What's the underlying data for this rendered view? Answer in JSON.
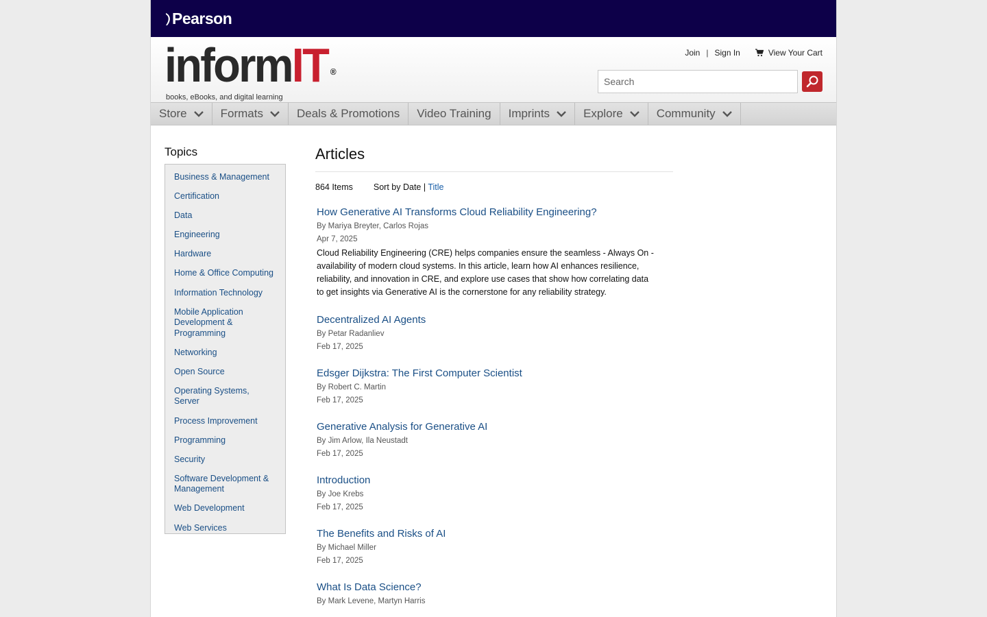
{
  "pearson": {
    "label": "Pearson"
  },
  "brand": {
    "inform": "inform",
    "it": "IT",
    "reg": "®",
    "tagline": "books, eBooks, and digital learning"
  },
  "account": {
    "join": "Join",
    "separator": "|",
    "signin": "Sign In",
    "cart": "View Your Cart"
  },
  "search": {
    "placeholder": "Search"
  },
  "nav": [
    {
      "label": "Store",
      "dropdown": true
    },
    {
      "label": "Formats",
      "dropdown": true
    },
    {
      "label": "Deals & Promotions",
      "dropdown": false
    },
    {
      "label": "Video Training",
      "dropdown": false
    },
    {
      "label": "Imprints",
      "dropdown": true
    },
    {
      "label": "Explore",
      "dropdown": true
    },
    {
      "label": "Community",
      "dropdown": true
    }
  ],
  "sidebar": {
    "title": "Topics",
    "items": [
      "Business & Management",
      "Certification",
      "Data",
      "Engineering",
      "Hardware",
      "Home & Office Computing",
      "Information Technology",
      "Mobile Application Development & Programming",
      "Networking",
      "Open Source",
      "Operating Systems, Server",
      "Process Improvement",
      "Programming",
      "Security",
      "Software Development & Management",
      "Web Development",
      "Web Services"
    ]
  },
  "main": {
    "title": "Articles",
    "count": "864 Items",
    "sort_prefix": "Sort by Date",
    "sort_sep": "|",
    "sort_title": "Title",
    "articles": [
      {
        "title": "How Generative AI Transforms Cloud Reliability Engineering?",
        "author": "By Mariya Breyter, Carlos Rojas",
        "date": "Apr 7, 2025",
        "desc": "Cloud Reliability Engineering (CRE) helps companies ensure the seamless - Always On - availability of modern cloud systems. In this article, learn how AI enhances resilience, reliability, and innovation in CRE, and explore use cases that show how correlating data to get insights via Generative AI is the cornerstone for any reliability strategy."
      },
      {
        "title": "Decentralized AI Agents",
        "author": "By Petar Radanliev",
        "date": "Feb 17, 2025",
        "desc": ""
      },
      {
        "title": "Edsger Dijkstra: The First Computer Scientist",
        "author": "By Robert C. Martin",
        "date": "Feb 17, 2025",
        "desc": ""
      },
      {
        "title": "Generative Analysis for Generative AI",
        "author": "By Jim Arlow, Ila Neustadt",
        "date": "Feb 17, 2025",
        "desc": ""
      },
      {
        "title": "Introduction",
        "author": "By Joe Krebs",
        "date": "Feb 17, 2025",
        "desc": ""
      },
      {
        "title": "The Benefits and Risks of AI",
        "author": "By Michael Miller",
        "date": "Feb 17, 2025",
        "desc": ""
      },
      {
        "title": "What Is Data Science?",
        "author": "By Mark Levene, Martyn Harris",
        "date": "",
        "desc": ""
      }
    ]
  },
  "colors": {
    "pearson_bar": "#0d0049",
    "accent_red": "#c8202f",
    "link_blue": "#1a4f86"
  }
}
